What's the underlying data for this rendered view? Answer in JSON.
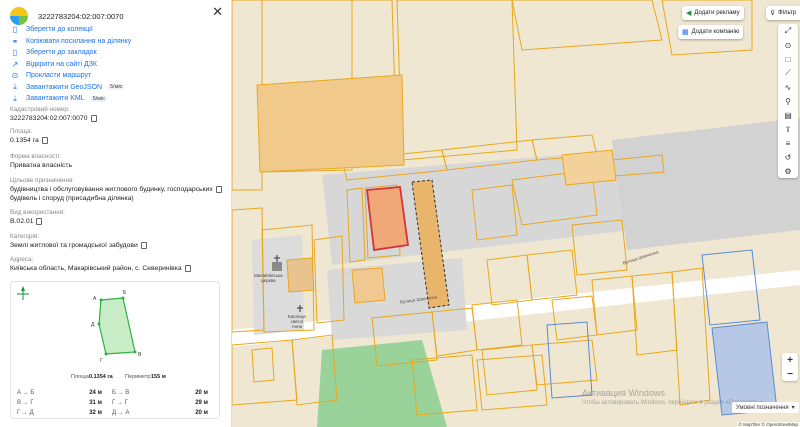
{
  "search": {
    "value": "3222783204:02:007:0070"
  },
  "actions": [
    {
      "icon": "bookmark-icon",
      "label": "Зберегти до колекції"
    },
    {
      "icon": "link-icon",
      "label": "Копіювати посилання на ділянку"
    },
    {
      "icon": "bookmark-icon",
      "label": "Зберегти до закладок"
    },
    {
      "icon": "external-link-icon",
      "label": "Відкрити на сайті ДЗК"
    },
    {
      "icon": "route-icon",
      "label": "Прокласти маршрут"
    },
    {
      "icon": "download-icon",
      "label": "Завантажити GeoJSON",
      "badge": "5/міс"
    },
    {
      "icon": "download-icon",
      "label": "Завантажити KML",
      "badge": "5/міс"
    }
  ],
  "fields": {
    "cadastre_label": "Кадастровий номер:",
    "cadastre_value": "3222783204:02:007:0070",
    "area_label": "Площа:",
    "area_value": "0.1354 га",
    "ownership_label": "Форма власності:",
    "ownership_value": "Приватна власність",
    "purpose_label": "Цільове призначення:",
    "purpose_value_1": "будівництва і обслуговування житлового будинку, господарських",
    "purpose_value_2": "будівель і споруд (присадибна ділянка)",
    "use_label": "Вид використання:",
    "use_value": "В.02.01",
    "category_label": "Категорія:",
    "category_value": "Землі житлової та громадської забудови",
    "address_label": "Адреса:",
    "address_value": "Київська область, Макарівський район, с. Северинівка"
  },
  "plot": {
    "vertex_labels": [
      "А",
      "Б",
      "В",
      "Г",
      "Д"
    ],
    "area_label": "Площа:",
    "area_value": "0.1354 га",
    "perimeter_label": "Периметр:",
    "perimeter_value": "155 м",
    "segments": [
      {
        "a": "А → Б",
        "av": "24 м",
        "b": "Б → В",
        "bv": "20 м"
      },
      {
        "a": "В → Г",
        "av": "31 м",
        "b": "Г → Г",
        "bv": "29 м"
      },
      {
        "a": "Г → Д",
        "av": "32 м",
        "b": "Д → А",
        "bv": "20 м"
      }
    ]
  },
  "map": {
    "ad_button": "Додати рекламу",
    "company_button": "Додати компанію",
    "filter_button": "Фільтр",
    "legend_button": "Умовні позначення",
    "street_1": "Вулиця Шевченка",
    "street_2": "Вулиця Шевченка",
    "church_label_1": "Михайлівська",
    "church_label_2": "церква",
    "chapel_label_1": "Каплиця",
    "chapel_label_2": "святої",
    "chapel_label_3": "Анни",
    "watermark": "Активация Windows",
    "watermark_sub": "Чтобы активировать Windows, перейдите в раздел «Параметры».",
    "attribution": "© MapTiler © OpenStreetMap",
    "zoom_in": "+",
    "zoom_out": "−",
    "toolbar_icons": [
      "expand-icon",
      "pin-icon",
      "square-icon",
      "ruler-icon",
      "line-icon",
      "pin-icon",
      "print-icon",
      "share-icon",
      "layers-icon",
      "history-icon",
      "settings-icon"
    ]
  },
  "colors": {
    "link": "#1a73e8",
    "parcel_border": "#e8a81c",
    "selected_parcel": "#d6323a",
    "building": "#d9d9d9",
    "water": "#5a8bd6",
    "park": "#9ad39a"
  }
}
